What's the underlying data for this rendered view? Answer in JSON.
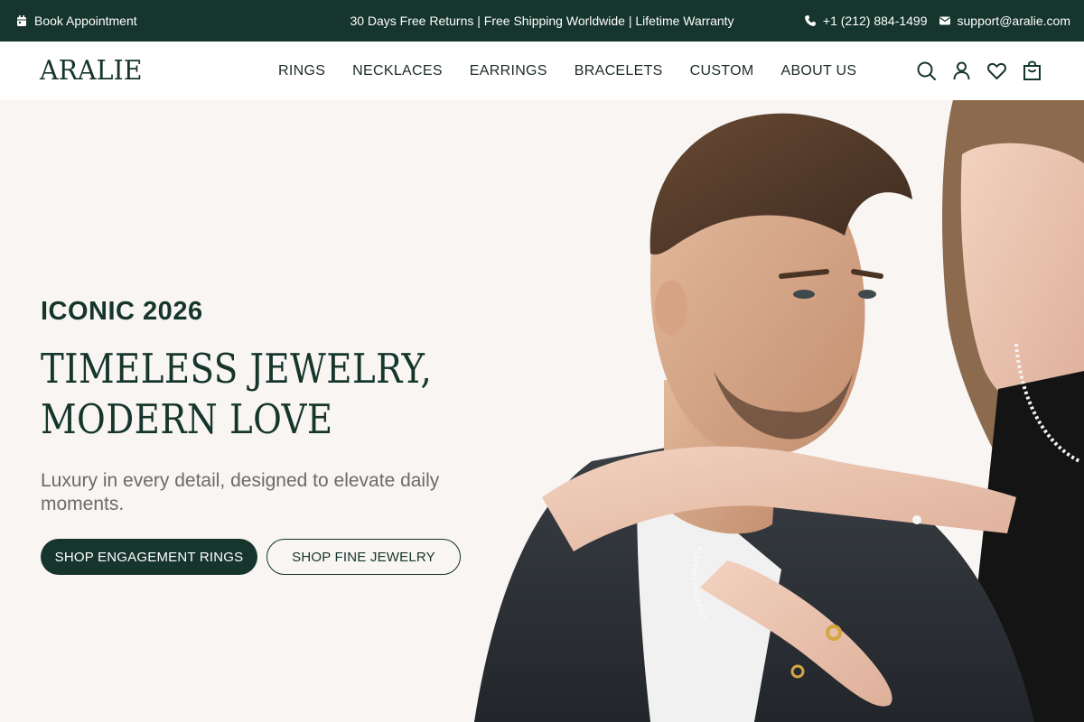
{
  "topbar": {
    "book_label": "Book Appointment",
    "promo": "30 Days Free Returns | Free Shipping Worldwide | Lifetime Warranty",
    "phone": "+1 (212) 884-1499",
    "email": "support@aralie.com",
    "icons": {
      "book": "calendar-icon",
      "phone": "phone-icon",
      "email": "envelope-icon"
    }
  },
  "header": {
    "logo": "ARALIE",
    "nav": [
      {
        "label": "RINGS"
      },
      {
        "label": "NECKLACES"
      },
      {
        "label": "EARRINGS"
      },
      {
        "label": "BRACELETS"
      },
      {
        "label": "CUSTOM"
      },
      {
        "label": "ABOUT US"
      }
    ],
    "icons": [
      "search-icon",
      "account-icon",
      "wishlist-heart-icon",
      "cart-bag-icon"
    ]
  },
  "hero": {
    "eyebrow": "ICONIC 2026",
    "headline_line1": "TIMELESS JEWELRY,",
    "headline_line2": "MODERN LOVE",
    "subtext": "Luxury in every detail, designed to elevate daily moments.",
    "primary_cta": "SHOP ENGAGEMENT RINGS",
    "secondary_cta": "SHOP FINE JEWELRY",
    "image": "couple-wearing-jewelry-photo"
  },
  "colors": {
    "brand_dark": "#15352d",
    "hero_bg": "#f8f5f2",
    "header_bg": "#ffffff",
    "subtext": "#6b6b6b"
  }
}
